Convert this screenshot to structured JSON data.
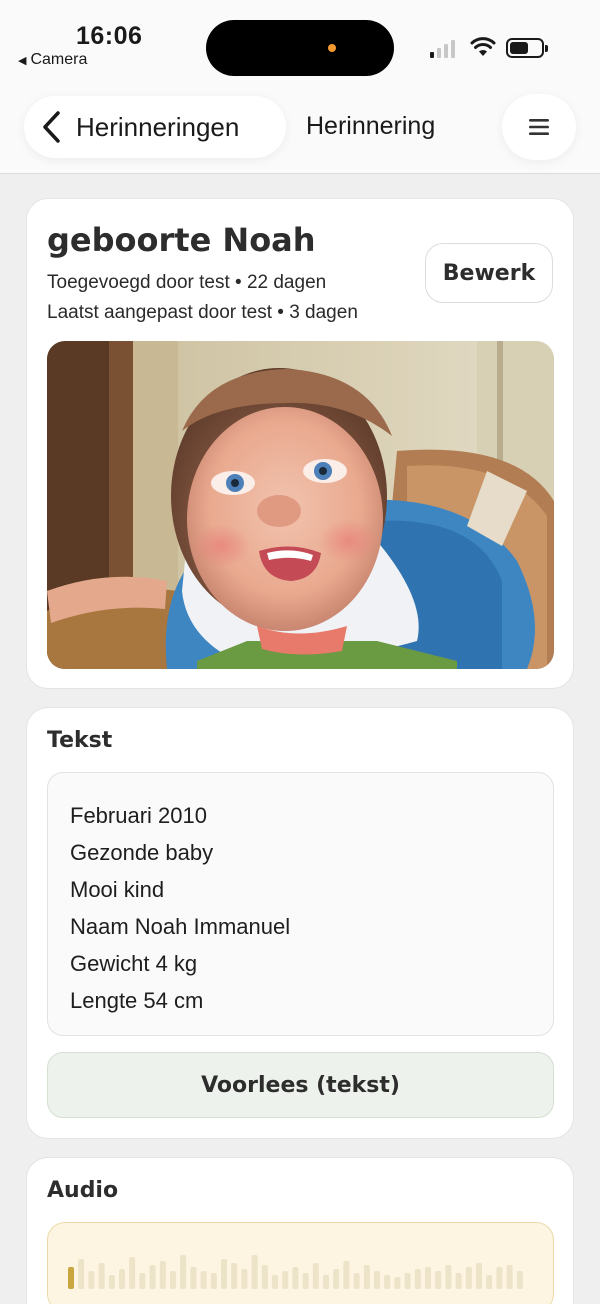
{
  "status_bar": {
    "time": "16:06",
    "back_app": "Camera"
  },
  "nav": {
    "back_label": "Herinneringen",
    "title": "Herinnering"
  },
  "memory": {
    "title": "geboorte Noah",
    "added_by": "Toegevoegd door test • 22 dagen",
    "modified_by": "Laatst aangepast door test • 3 dagen",
    "edit_label": "Bewerk"
  },
  "text_section": {
    "heading": "Tekst",
    "lines": [
      "Februari 2010",
      "Gezonde baby",
      "Mooi kind",
      "Naam Noah Immanuel",
      "Gewicht 4 kg",
      "Lengte 54 cm"
    ],
    "read_label": "Voorlees (tekst)"
  },
  "audio_section": {
    "heading": "Audio"
  },
  "colors": {
    "accent_audio_bar": "#c9a640",
    "read_button_bg": "#eef2ec",
    "audio_bg": "#fdf5e2"
  }
}
